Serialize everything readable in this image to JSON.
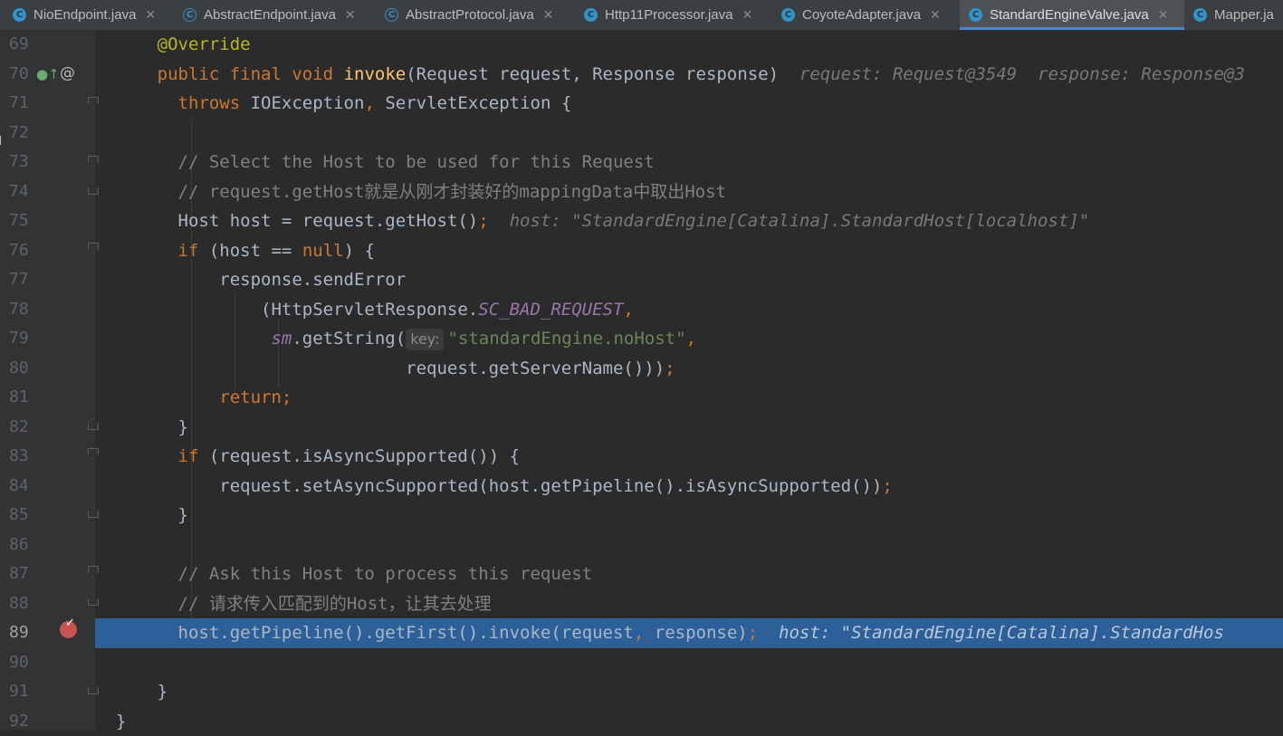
{
  "tabs": [
    {
      "label": "NioEndpoint.java",
      "icon": "class-icon",
      "active": false
    },
    {
      "label": "AbstractEndpoint.java",
      "icon": "abstract-class-icon",
      "active": false
    },
    {
      "label": "AbstractProtocol.java",
      "icon": "abstract-class-icon",
      "active": false
    },
    {
      "label": "Http11Processor.java",
      "icon": "class-icon",
      "active": false
    },
    {
      "label": "CoyoteAdapter.java",
      "icon": "class-icon",
      "active": false
    },
    {
      "label": "StandardEngineValve.java",
      "icon": "class-icon",
      "active": true
    },
    {
      "label": "Mapper.ja",
      "icon": "class-icon",
      "active": false
    }
  ],
  "tab_close_glyph": "✕",
  "line_numbers": [
    "69",
    "70",
    "71",
    "72",
    "73",
    "74",
    "75",
    "76",
    "77",
    "78",
    "79",
    "80",
    "81",
    "82",
    "83",
    "84",
    "85",
    "86",
    "87",
    "88",
    "89",
    "90",
    "91",
    "92"
  ],
  "current_line": "89",
  "gutter": {
    "override_icon": "override-method-icon",
    "at_glyph": "@",
    "breakpoint_line": "89"
  },
  "code": {
    "l69": {
      "ann": "@Override"
    },
    "l70": {
      "kw1": "public final void",
      "fn": "invoke",
      "sig": "(Request request, Response response)",
      "hint": "request: Request@3549  response: Response@3"
    },
    "l71": {
      "kw": "throws",
      "t1": "IOException",
      "p1": ",",
      "t2": "ServletException {"
    },
    "l73": {
      "cm": "// Select the Host to be used for this Request"
    },
    "l74": {
      "cm": "// request.getHost就是从刚才封装好的mappingData中取出Host"
    },
    "l75": {
      "t": "Host host = request.getHost()",
      "p": ";",
      "hint": "host: \"StandardEngine[Catalina].StandardHost[localhost]\""
    },
    "l76": {
      "kw": "if",
      "t1": "(host ==",
      "kw2": "null",
      "t2": ") {"
    },
    "l77": {
      "t": "response.sendError"
    },
    "l78": {
      "t": "(HttpServletResponse.",
      "const": "SC_BAD_REQUEST",
      "p": ","
    },
    "l79": {
      "const": "sm",
      "t": ".getString(",
      "pname": "key:",
      "str": "\"standardEngine.noHost\"",
      "p": ","
    },
    "l80": {
      "t": "request.getServerName()))",
      "p": ";"
    },
    "l81": {
      "kw": "return",
      "p": ";"
    },
    "l82": {
      "t": "}"
    },
    "l83": {
      "kw": "if",
      "t": "(request.isAsyncSupported()) {"
    },
    "l84": {
      "t": "request.setAsyncSupported(host.getPipeline().isAsyncSupported())",
      "p": ";"
    },
    "l85": {
      "t": "}"
    },
    "l87": {
      "cm": "// Ask this Host to process this request"
    },
    "l88": {
      "cm": "// 请求传入匹配到的Host，让其去处理"
    },
    "l89": {
      "t1": "host.getPipeline().getFirst().invoke(request",
      "p1": ",",
      "t2": "response)",
      "p2": ";",
      "hint": "host: \"StandardEngine[Catalina].StandardHos"
    },
    "l91": {
      "t": "}"
    },
    "l92": {
      "t": "}"
    }
  }
}
